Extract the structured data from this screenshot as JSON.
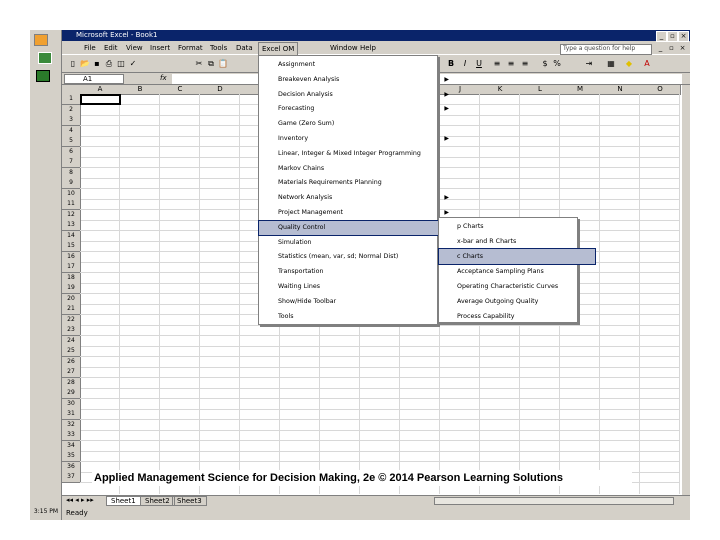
{
  "window": {
    "title": "Microsoft Excel - Book1"
  },
  "menubar": {
    "items": [
      "File",
      "Edit",
      "View",
      "Insert",
      "Format",
      "Tools",
      "Data",
      "Excel OM",
      "Window",
      "Help"
    ],
    "help_placeholder": "Type a question for help"
  },
  "formula_bar": {
    "name_box": "A1",
    "fx": "fx"
  },
  "columns": [
    "A",
    "B",
    "C",
    "D",
    "E",
    "F",
    "G",
    "H",
    "I",
    "J",
    "K",
    "L",
    "M",
    "N",
    "O"
  ],
  "rows": [
    "1",
    "2",
    "3",
    "4",
    "5",
    "6",
    "7",
    "8",
    "9",
    "10",
    "11",
    "12",
    "13",
    "14",
    "15",
    "16",
    "17",
    "18",
    "19",
    "20",
    "21",
    "22",
    "23",
    "24",
    "25",
    "26",
    "27",
    "28",
    "29",
    "30",
    "31",
    "32",
    "33",
    "34",
    "35",
    "36",
    "37"
  ],
  "menu": {
    "items": [
      {
        "label": "Assignment",
        "arrow": ""
      },
      {
        "label": "Breakeven Analysis",
        "arrow": "▶"
      },
      {
        "label": "Decision Analysis",
        "arrow": "▶"
      },
      {
        "label": "Forecasting",
        "arrow": "▶"
      },
      {
        "label": "Game (Zero Sum)",
        "arrow": ""
      },
      {
        "label": "Inventory",
        "arrow": "▶"
      },
      {
        "label": "Linear, Integer & Mixed Integer Programming",
        "arrow": ""
      },
      {
        "label": "Markov Chains",
        "arrow": ""
      },
      {
        "label": "Materials Requirements Planning",
        "arrow": ""
      },
      {
        "label": "Network Analysis",
        "arrow": "▶"
      },
      {
        "label": "Project Management",
        "arrow": "▶"
      },
      {
        "label": "Quality Control",
        "arrow": "▶"
      },
      {
        "label": "Simulation",
        "arrow": ""
      },
      {
        "label": "Statistics (mean, var, sd; Normal Dist)",
        "arrow": "▶"
      },
      {
        "label": "Transportation",
        "arrow": ""
      },
      {
        "label": "Waiting Lines",
        "arrow": "▶"
      },
      {
        "label": "Show/Hide Toolbar",
        "arrow": ""
      },
      {
        "label": "Tools",
        "arrow": "▶"
      }
    ]
  },
  "submenu": {
    "items": [
      "p Charts",
      "x-bar and R Charts",
      "c Charts",
      "Acceptance Sampling Plans",
      "Operating Characteristic Curves",
      "Average Outgoing Quality",
      "Process Capability"
    ]
  },
  "sheet_tabs": [
    "Sheet1",
    "Sheet2",
    "Sheet3"
  ],
  "status": "Ready",
  "taskbar": {
    "clock": "3:15 PM"
  },
  "caption": "Applied Management Science for Decision Making, 2e © 2014 Pearson Learning Solutions"
}
